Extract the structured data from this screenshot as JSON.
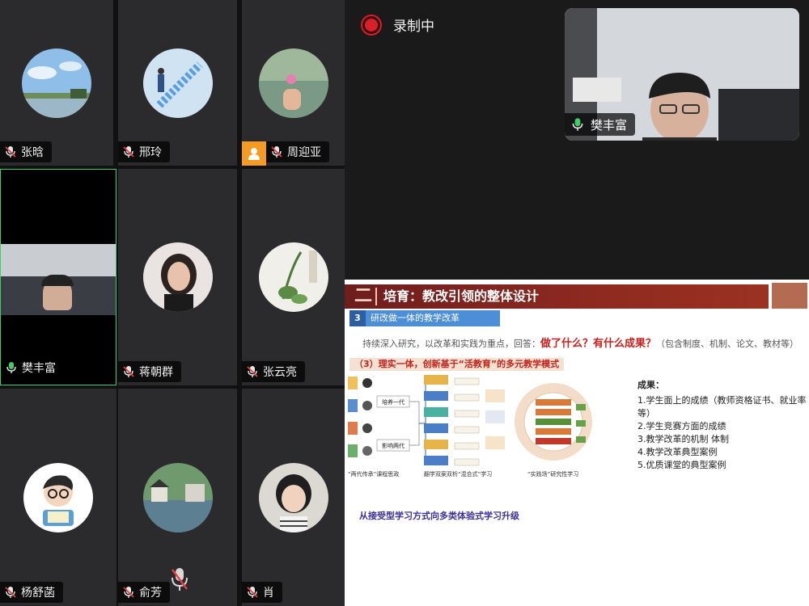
{
  "participants": [
    {
      "name": "张晗"
    },
    {
      "name": "邢玲"
    },
    {
      "name": "周迎亚"
    },
    {
      "name": "樊丰富"
    },
    {
      "name": "蒋朝群"
    },
    {
      "name": "张云亮"
    },
    {
      "name": "杨舒菡"
    },
    {
      "name": "俞芳"
    },
    {
      "name": "肖"
    }
  ],
  "recording": {
    "label": "录制中"
  },
  "active_speaker": {
    "name": "樊丰富"
  },
  "slide": {
    "section_no": "二",
    "title": "培育：教改引领的整体设计",
    "part_no": "3",
    "part_title": "研改做一体的教学改革",
    "lead_prefix": "持续深入研究，以改革和实践为重点，回答：",
    "lead_emph": "做了什么？有什么成果？",
    "lead_suffix": "（包含制度、机制、论文、教材等）",
    "subtitle": "（3）理实一体，创新基于“活教育”的多元教学模式",
    "diagram_labels": [
      "培养一代",
      "影响两代"
    ],
    "captions": [
      "“两代传承”课程思政",
      "翻学双案双析“混合式”学习",
      "“实践场”研究性学习"
    ],
    "results_heading": "成果：",
    "results": [
      "1.学生面上的成绩（教师资格证书、就业率等）",
      "2.学生竞赛方面的成绩",
      "3.教学改革的机制 体制",
      "4.教学改革典型案例",
      "5.优质课堂的典型案例"
    ],
    "footer": "从接受型学习方式向多类体验式学习升级"
  },
  "colors": {
    "active_border": "#3ecf6a",
    "record_dot": "#d91f2a",
    "slide_header": "#8e2a20",
    "accent_red": "#c8201b",
    "section_blue": "#4d8fd6"
  }
}
